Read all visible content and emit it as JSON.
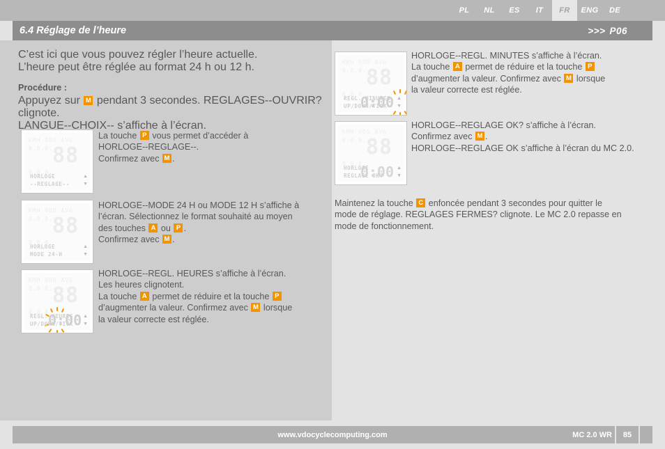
{
  "language_bar": {
    "tabs": [
      {
        "code": "PL",
        "active": false
      },
      {
        "code": "NL",
        "active": false
      },
      {
        "code": "ES",
        "active": false
      },
      {
        "code": "IT",
        "active": false
      },
      {
        "code": "FR",
        "active": true
      },
      {
        "code": "ENG",
        "active": false
      },
      {
        "code": "DE",
        "active": false
      }
    ]
  },
  "header": {
    "chapter_title": "6.4 Réglage de l’heure",
    "page_arrows": ">>>",
    "page_ref": "P06"
  },
  "left_column": {
    "intro_line1": "C’est ici que vous pouvez régler l’heure actuelle.",
    "intro_line2": "L’heure peut être réglée au format 24 h ou 12 h.",
    "procedure_heading": "Procédure :",
    "procedure_line1_a": "Appuyez  sur ",
    "procedure_key1": "M",
    "procedure_line1_b": " pendant 3 secondes. REGLAGES--OUVRIR? clignote.",
    "procedure_line2": "LANGUE--CHOIX-- s’affiche à l’écran.",
    "step1": {
      "t1a": "La touche ",
      "key1": "P",
      "t1b": " vous permet d’accéder à",
      "t2": "HORLOGE--REGLAGE--.",
      "t3a": "Confirmez avec ",
      "key2": "M",
      "t3b": "."
    },
    "step2": {
      "t1": "HORLOGE--MODE 24 H ou MODE 12 H s’affiche à",
      "t2": "l’écran. Sélectionnez le format souhaité au moyen",
      "t3a": "des touches ",
      "key1": "A",
      "t3b": " ou ",
      "key2": "P",
      "t3c": ".",
      "t4a": "Confirmez avec ",
      "key3": "M",
      "t4b": "."
    },
    "step3": {
      "t1": "HORLOGE--REGL. HEURES s’affiche à l’écran.",
      "t2": "Les heures clignotent.",
      "t3a": "La touche ",
      "key1": "A",
      "t3b": " permet de réduire et la touche ",
      "key2": "P",
      "t4a": "d’augmenter la valeur. Confirmez avec ",
      "key3": "M",
      "t4b": " lorsque",
      "t5": "la valeur correcte est réglée."
    }
  },
  "right_column": {
    "step4": {
      "t1": "HORLOGE--REGL. MINUTES s’affiche à l’écran.",
      "t2a": "La touche ",
      "key1": "A",
      "t2b": " permet de réduire et la touche ",
      "key2": "P",
      "t3a": "d’augmenter la valeur. Confirmez avec ",
      "key3": "M",
      "t3b": " lorsque",
      "t4": "la valeur correcte est réglée."
    },
    "step5": {
      "t1": "HORLOGE--REGLAGE OK? s’affiche à l’écran.",
      "t2a": "Confirmez avec ",
      "key1": "M",
      "t2b": ".",
      "t3": "HORLOGE--REGLAGE OK s’affiche à l’écran du MC 2.0."
    },
    "closing": {
      "t1a": "Maintenez la touche ",
      "key1": "C",
      "t1b": " enfoncée pendant 3 secondes pour quitter le",
      "t2": "mode de réglage. REGLAGES FERMES? clignote. Le MC 2.0 repasse en",
      "t3": "mode de fonctionnement."
    }
  },
  "lcd_displays": [
    {
      "id": "lcd-horloge-reglage",
      "ghost_top": "KMH ODO AVG",
      "ghost_sub": "8.8.8.",
      "big_digits": "88",
      "value": "",
      "label_line1": "HORLOGE",
      "label_line2": "--REGLAGE--",
      "blink": false
    },
    {
      "id": "lcd-horloge-mode24h",
      "ghost_top": "KMH ODO AVG",
      "ghost_sub": "8.8.8.",
      "big_digits": "88",
      "value": "",
      "label_line1": "HORLOGE",
      "label_line2": "MODE 24-H",
      "blink": false
    },
    {
      "id": "lcd-regl-heures",
      "ghost_top": "KMH ODO AVG",
      "ghost_sub": "8.8.8.",
      "big_digits": "88",
      "value": "0:00",
      "label_line1": "REGL. HEURES",
      "label_line2": "UP/DOWN/TICK",
      "blink": true
    },
    {
      "id": "lcd-regl-minutes",
      "ghost_top": "KMH ODO AVG",
      "ghost_sub": "8.8.8.",
      "big_digits": "88",
      "value": "0:00",
      "label_line1": "REGL. MINUTES",
      "label_line2": "UP/DOWN/TICK",
      "blink": true
    },
    {
      "id": "lcd-reglage-ok",
      "ghost_top": "KMH ODO AVG",
      "ghost_sub": "8.8.8.",
      "big_digits": "88",
      "value": "0:00",
      "label_line1": "HORLOGE",
      "label_line2": "REGLAGE OK?",
      "blink": false
    }
  ],
  "footer": {
    "url": "www.vdocyclecomputing.com",
    "model": "MC 2.0 WR",
    "page_number": "85"
  },
  "colors": {
    "accent": "#f29400",
    "title_bar": "#8d8d8d",
    "lang_bar": "#b8b8b8",
    "left_panel": "#cdcdcd",
    "page_bg": "#e3e3e3",
    "text": "#58585a",
    "footer_bar": "#b0b0b0"
  }
}
